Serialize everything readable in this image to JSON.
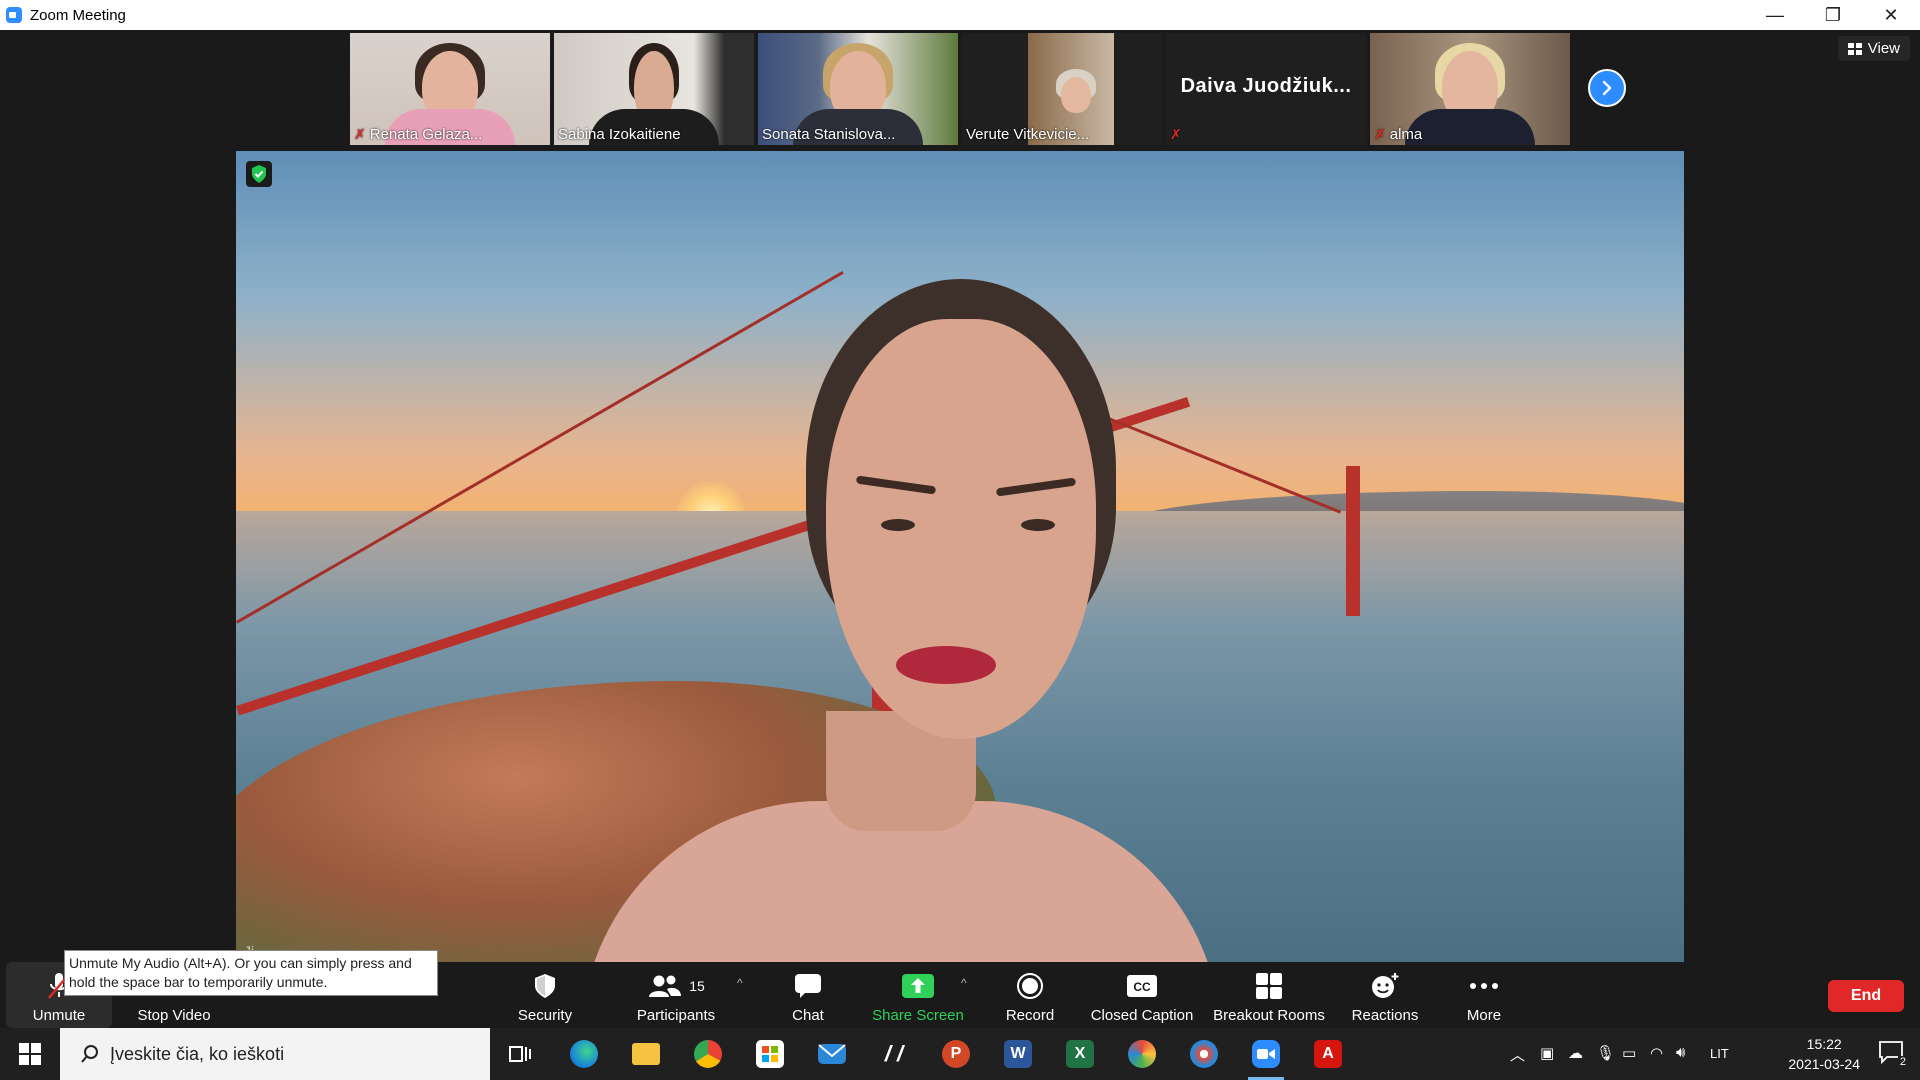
{
  "window": {
    "title": "Zoom Meeting",
    "minimize": "—",
    "restore": "❐",
    "close": "✕"
  },
  "thumbnails": [
    {
      "name": "Renata Gelaza...",
      "muted": true
    },
    {
      "name": "Sabina Izokaitiene",
      "muted": false
    },
    {
      "name": "Sonata Stanislova...",
      "muted": false
    },
    {
      "name": "Verute Vitkevicie...",
      "muted": false
    },
    {
      "name": "Daiva  Juodžiuk...",
      "muted": true,
      "video": false
    },
    {
      "name": "alma",
      "muted": true
    }
  ],
  "view_button": "View",
  "main_video": {
    "overlay_name": "Ji..."
  },
  "toolbar": {
    "unmute": "Unmute",
    "stop_video": "Stop Video",
    "security": "Security",
    "participants": "Participants",
    "participants_count": "15",
    "chat": "Chat",
    "share_screen": "Share Screen",
    "record": "Record",
    "closed_caption": "Closed Caption",
    "breakout_rooms": "Breakout Rooms",
    "reactions": "Reactions",
    "more": "More",
    "end": "End",
    "caret": "^"
  },
  "tooltip": "Unmute My Audio (Alt+A). Or you can simply press and hold the space bar to temporarily unmute.",
  "taskbar": {
    "search_placeholder": "Įveskite čia, ko ieškoti",
    "language": "LIT",
    "time": "15:22",
    "date": "2021-03-24",
    "notifications": "2"
  },
  "colors": {
    "accent": "#2d8cff",
    "end": "#e02828",
    "share": "#30d158"
  }
}
